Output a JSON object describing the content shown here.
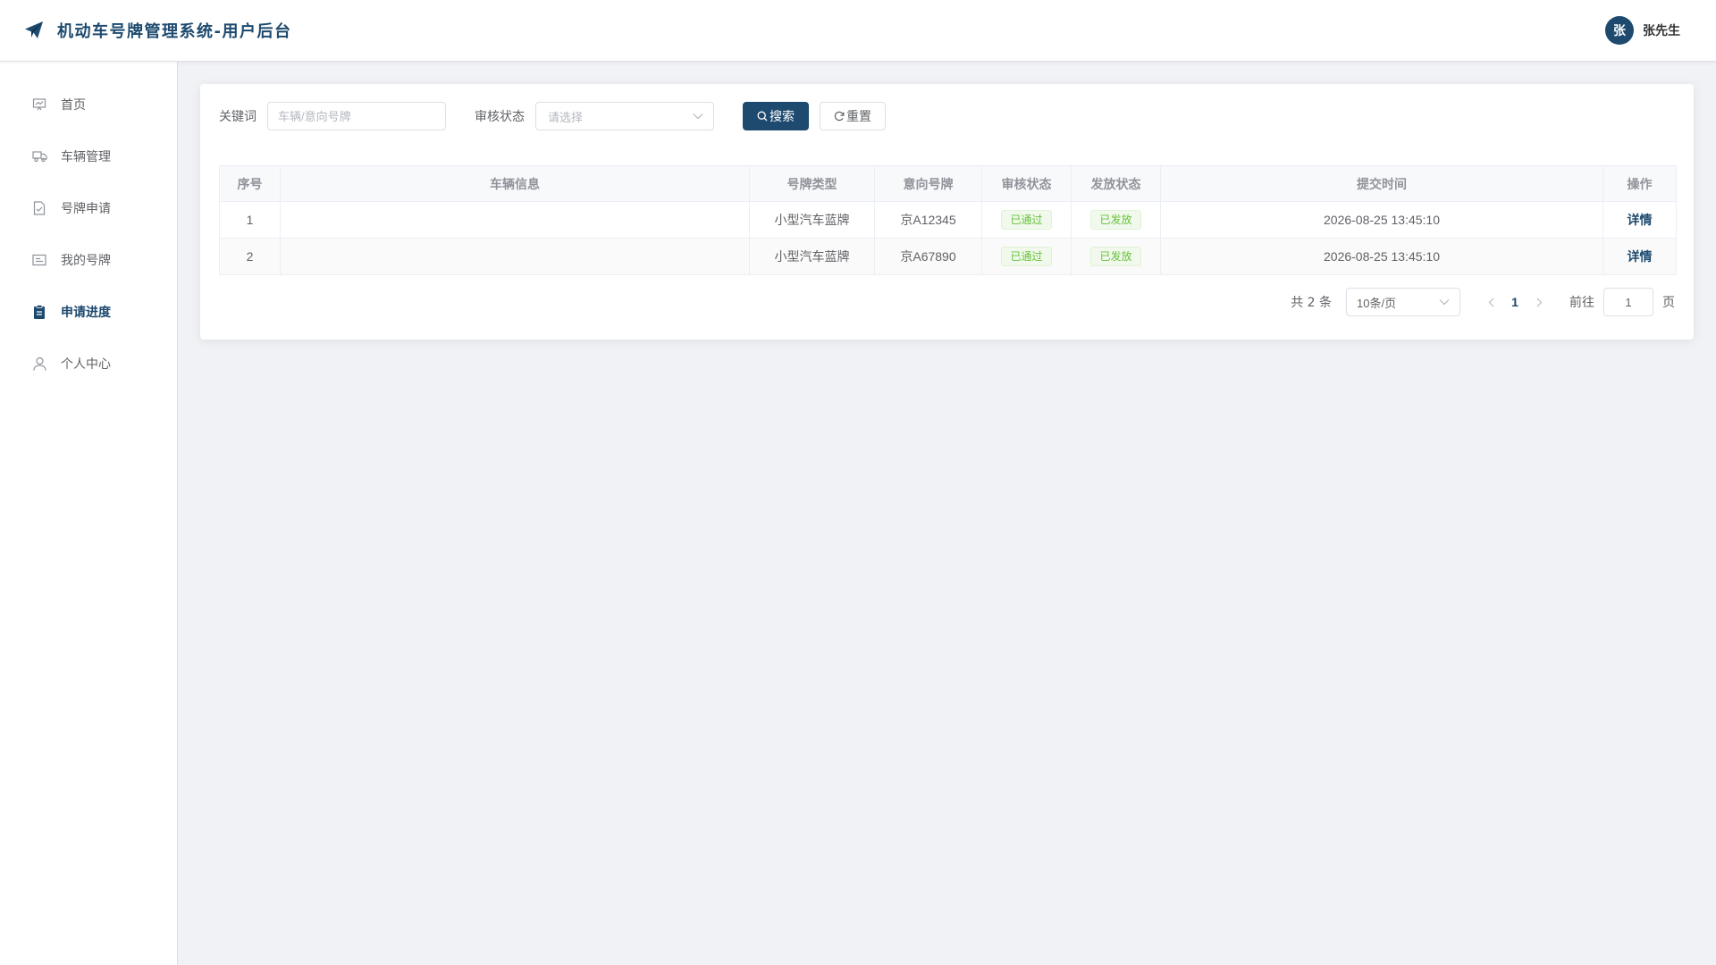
{
  "header": {
    "title": "机动车号牌管理系统-用户后台",
    "user_initial": "张",
    "user_name": "张先生"
  },
  "sidebar": {
    "items": [
      {
        "label": "首页",
        "icon": "dashboard-icon"
      },
      {
        "label": "车辆管理",
        "icon": "truck-icon"
      },
      {
        "label": "号牌申请",
        "icon": "document-icon"
      },
      {
        "label": "我的号牌",
        "icon": "card-icon"
      },
      {
        "label": "申请进度",
        "icon": "clipboard-icon",
        "active": true
      },
      {
        "label": "个人中心",
        "icon": "user-icon"
      }
    ]
  },
  "filters": {
    "keyword_label": "关键词",
    "keyword_placeholder": "车辆/意向号牌",
    "status_label": "审核状态",
    "status_placeholder": "请选择",
    "search_label": "搜索",
    "reset_label": "重置"
  },
  "table": {
    "columns": [
      "序号",
      "车辆信息",
      "号牌类型",
      "意向号牌",
      "审核状态",
      "发放状态",
      "提交时间",
      "操作"
    ],
    "rows": [
      {
        "index": "1",
        "vehicle": "",
        "plate_type": "小型汽车蓝牌",
        "plate": "京A12345",
        "audit": "已通过",
        "issue": "已发放",
        "time": "2026-08-25 13:45:10",
        "action": "详情"
      },
      {
        "index": "2",
        "vehicle": "",
        "plate_type": "小型汽车蓝牌",
        "plate": "京A67890",
        "audit": "已通过",
        "issue": "已发放",
        "time": "2026-08-25 13:45:10",
        "action": "详情"
      }
    ]
  },
  "pagination": {
    "total": "共 2 条",
    "page_size": "10条/页",
    "current_page": "1",
    "goto_label": "前往",
    "goto_value": "1",
    "page_unit": "页"
  },
  "colors": {
    "primary": "#1d4a6e",
    "success": "#67c23a",
    "background": "#f0f2f5"
  }
}
